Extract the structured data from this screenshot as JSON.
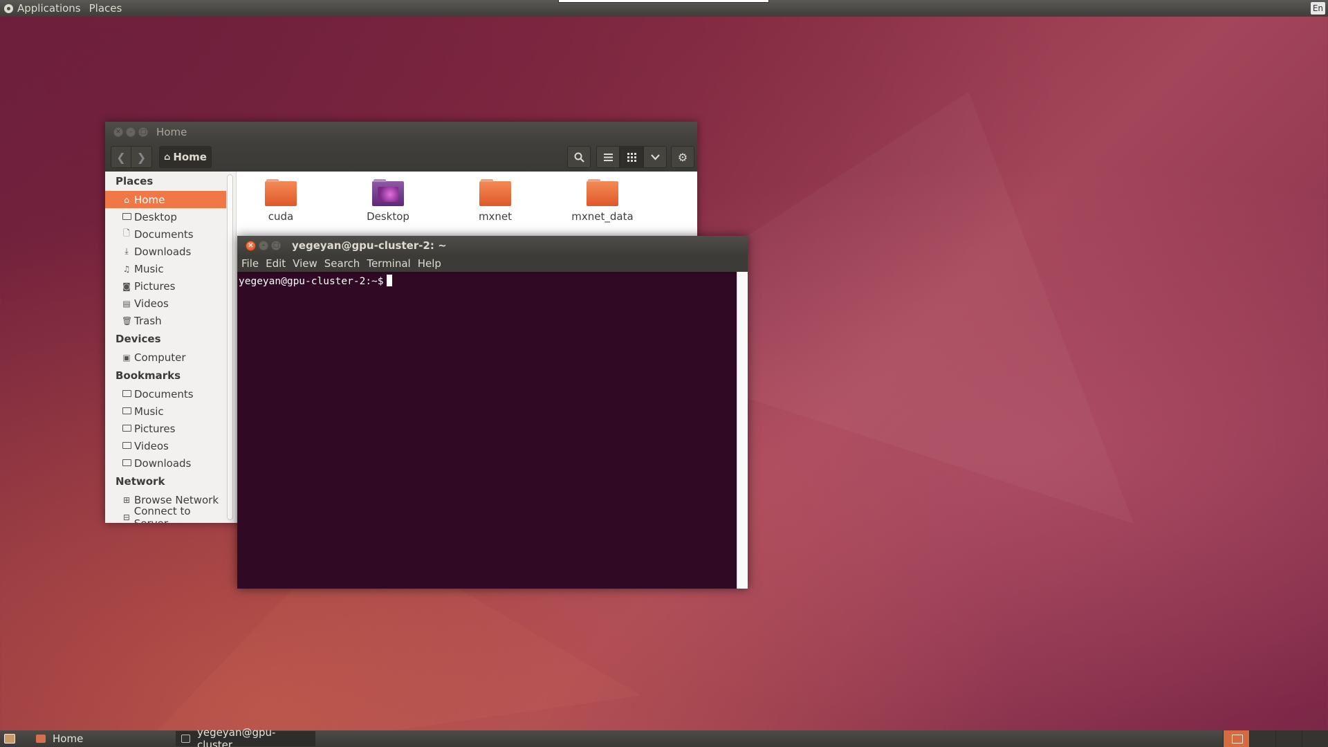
{
  "top_panel": {
    "applications_label": "Applications",
    "places_label": "Places",
    "keyboard_layout": "En"
  },
  "nautilus": {
    "window_title": "Home",
    "path_button": "Home",
    "sidebar": {
      "places_header": "Places",
      "places": [
        {
          "label": "Home",
          "icon": "home-icon",
          "selected": true
        },
        {
          "label": "Desktop",
          "icon": "folder-icon"
        },
        {
          "label": "Documents",
          "icon": "document-icon"
        },
        {
          "label": "Downloads",
          "icon": "download-icon"
        },
        {
          "label": "Music",
          "icon": "music-icon"
        },
        {
          "label": "Pictures",
          "icon": "camera-icon"
        },
        {
          "label": "Videos",
          "icon": "film-icon"
        },
        {
          "label": "Trash",
          "icon": "trash-icon"
        }
      ],
      "devices_header": "Devices",
      "devices": [
        {
          "label": "Computer",
          "icon": "computer-icon"
        }
      ],
      "bookmarks_header": "Bookmarks",
      "bookmarks": [
        {
          "label": "Documents",
          "icon": "folder-icon"
        },
        {
          "label": "Music",
          "icon": "folder-icon"
        },
        {
          "label": "Pictures",
          "icon": "folder-icon"
        },
        {
          "label": "Videos",
          "icon": "folder-icon"
        },
        {
          "label": "Downloads",
          "icon": "folder-icon"
        }
      ],
      "network_header": "Network",
      "network": [
        {
          "label": "Browse Network",
          "icon": "network-icon"
        },
        {
          "label": "Connect to Server",
          "icon": "server-icon"
        }
      ]
    },
    "files": [
      {
        "name": "cuda",
        "type": "folder"
      },
      {
        "name": "Desktop",
        "type": "desktop-folder"
      },
      {
        "name": "mxnet",
        "type": "folder"
      },
      {
        "name": "mxnet_data",
        "type": "folder"
      }
    ]
  },
  "terminal": {
    "window_title": "yegeyan@gpu-cluster-2: ~",
    "menu": [
      "File",
      "Edit",
      "View",
      "Search",
      "Terminal",
      "Help"
    ],
    "prompt": "yegeyan@gpu-cluster-2:~$"
  },
  "bottom_panel": {
    "tasks": [
      {
        "label": "Home",
        "icon": "file-manager-icon"
      },
      {
        "label": "yegeyan@gpu-cluster...",
        "icon": "terminal-icon"
      }
    ]
  },
  "colors": {
    "accent": "#f07746",
    "terminal_bg": "#300a24",
    "panel_bg": "#3e3d3a"
  }
}
